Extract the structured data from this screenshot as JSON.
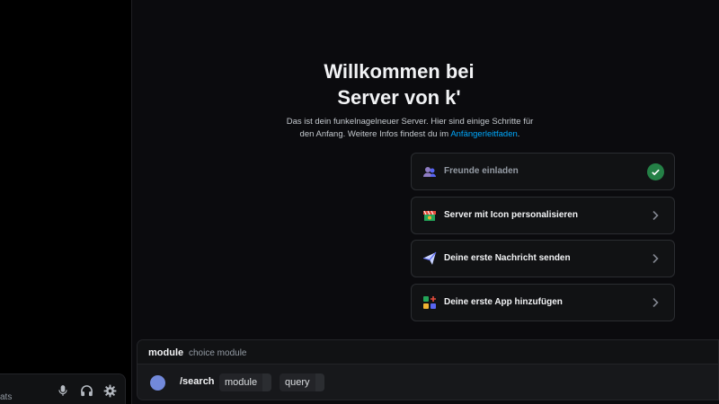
{
  "sidebar": {
    "user_status": "ats",
    "buttons": [
      {
        "name": "microphone",
        "icon": "microphone-icon"
      },
      {
        "name": "headphones",
        "icon": "headphones-icon"
      },
      {
        "name": "settings",
        "icon": "gear-icon"
      }
    ]
  },
  "welcome": {
    "title_line1": "Willkommen bei",
    "title_line2": "Server von k'",
    "subtitle_text": "Das ist dein funkelnagelneuer Server. Hier sind einige Schritte für den Anfang. Weitere Infos findest du im ",
    "subtitle_link": "Anfängerleitfaden",
    "subtitle_end": "."
  },
  "tasks": [
    {
      "label": "Freunde einladen",
      "icon": "invite-friends-icon",
      "done": true
    },
    {
      "label": "Server mit Icon personalisieren",
      "icon": "server-icon-customize-icon",
      "done": false
    },
    {
      "label": "Deine erste Nachricht senden",
      "icon": "paper-plane-icon",
      "done": false
    },
    {
      "label": "Deine erste App hinzufügen",
      "icon": "add-app-icon",
      "done": false
    }
  ],
  "command": {
    "option_name": "module",
    "option_desc": "choice module",
    "command_name": "/search",
    "params": [
      "module",
      "query"
    ]
  },
  "colors": {
    "accent_link": "#00a8fc",
    "success": "#248046",
    "bot_avatar": "#7289da"
  }
}
